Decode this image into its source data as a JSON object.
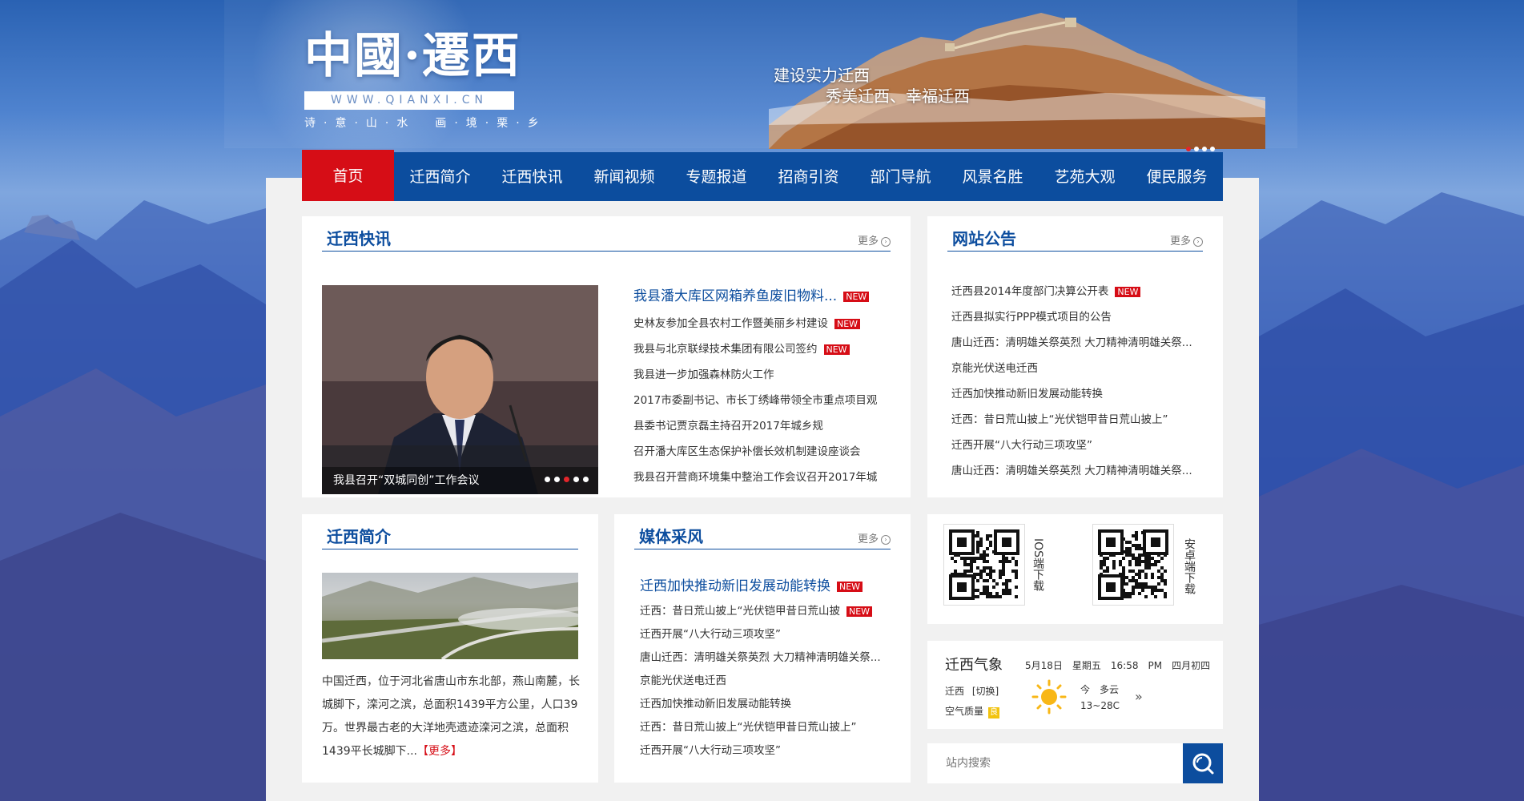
{
  "header": {
    "logo_title": "中國·遷西",
    "logo_url": "WWW.QIANXI.CN",
    "logo_motto": "诗·意·山·水　画·境·栗·乡",
    "slogan_line1": "建设实力迁西",
    "slogan_line2": "秀美迁西、幸福迁西"
  },
  "nav": [
    "首页",
    "迁西简介",
    "迁西快讯",
    "新闻视频",
    "专题报道",
    "招商引资",
    "部门导航",
    "风景名胜",
    "艺苑大观",
    "便民服务"
  ],
  "more_label": "更多",
  "new_badge": "NEW",
  "kuaixun": {
    "title": "迁西快讯",
    "slide_caption": "我县召开“双城同创”工作会议",
    "items": [
      {
        "text": "我县潘大库区网箱养鱼废旧物料...",
        "is_new": true
      },
      {
        "text": "史林友参加全县农村工作暨美丽乡村建设",
        "is_new": true
      },
      {
        "text": "我县与北京联绿技术集团有限公司签约",
        "is_new": true
      },
      {
        "text": "我县进一步加强森林防火工作",
        "is_new": false
      },
      {
        "text": "2017市委副书记、市长丁绣峰带领全市重点项目观",
        "is_new": false
      },
      {
        "text": "县委书记贾京磊主持召开2017年城乡规",
        "is_new": false
      },
      {
        "text": "召开潘大库区生态保护补偿长效机制建设座谈会",
        "is_new": false
      },
      {
        "text": "我县召开营商环境集中整治工作会议召开2017年城",
        "is_new": false
      }
    ]
  },
  "gonggao": {
    "title": "网站公告",
    "items": [
      {
        "text": "迁西县2014年度部门决算公开表",
        "is_new": true
      },
      {
        "text": "迁西县拟实行PPP模式项目的公告",
        "is_new": false
      },
      {
        "text": "唐山迁西：清明雄关祭英烈 大刀精神清明雄关祭...",
        "is_new": false
      },
      {
        "text": "京能光伏送电迁西",
        "is_new": false
      },
      {
        "text": "迁西加快推动新旧发展动能转换",
        "is_new": false
      },
      {
        "text": "迁西：昔日荒山披上“光伏铠甲昔日荒山披上”",
        "is_new": false
      },
      {
        "text": "迁西开展“八大行动三项攻坚”",
        "is_new": false
      },
      {
        "text": "唐山迁西：清明雄关祭英烈 大刀精神清明雄关祭...",
        "is_new": false
      }
    ]
  },
  "jianjie": {
    "title": "迁西简介",
    "text": "中国迁西，位于河北省唐山市东北部，燕山南麓，长城脚下，滦河之滨，总面积1439平方公里，人口39万。世界最古老的大洋地壳遗迹滦河之滨，总面积1439平长城脚下...",
    "more": "【更多】"
  },
  "meiti": {
    "title": "媒体采风",
    "items": [
      {
        "text": "迁西加快推动新旧发展动能转换",
        "is_new": true
      },
      {
        "text": "迁西：昔日荒山披上“光伏铠甲昔日荒山披",
        "is_new": true
      },
      {
        "text": "迁西开展“八大行动三项攻坚”",
        "is_new": false
      },
      {
        "text": "唐山迁西：清明雄关祭英烈 大刀精神清明雄关祭...",
        "is_new": false
      },
      {
        "text": "京能光伏送电迁西",
        "is_new": false
      },
      {
        "text": "迁西加快推动新旧发展动能转换",
        "is_new": false
      },
      {
        "text": "迁西：昔日荒山披上“光伏铠甲昔日荒山披上”",
        "is_new": false
      },
      {
        "text": "迁西开展“八大行动三项攻坚”",
        "is_new": false
      }
    ]
  },
  "apps": {
    "ios_label": "IOS端下载",
    "android_label": "安卓端下载"
  },
  "weather": {
    "title": "迁西气象",
    "datetime": "5月18日　星期五　16:58　PM　四月初四",
    "city": "迁西",
    "switch": "[切换]",
    "air_label": "空气质量",
    "air_value": "良",
    "today": "今　多云",
    "temp": "13~28C",
    "arrow": "»"
  },
  "search": {
    "placeholder": "站内搜索"
  },
  "colors": {
    "primary": "#0c4d9e",
    "accent": "#d60d16",
    "sun": "#f8b717"
  }
}
